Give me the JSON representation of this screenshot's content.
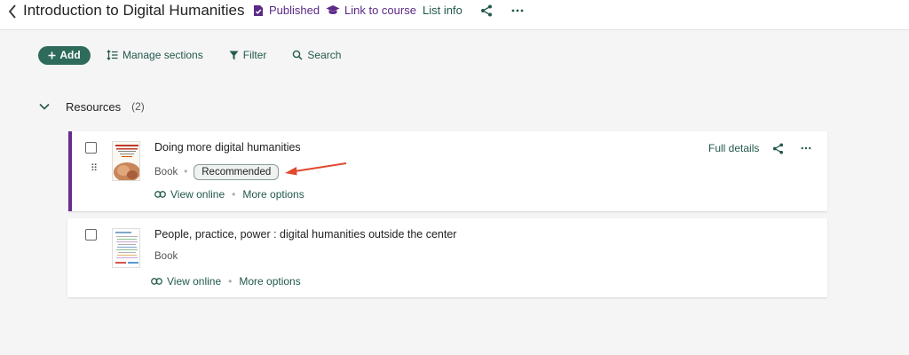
{
  "header": {
    "title": "Introduction to Digital Humanities",
    "published_label": "Published",
    "link_to_course_label": "Link to course",
    "list_info_label": "List info"
  },
  "toolbar": {
    "add_label": "Add",
    "manage_sections_label": "Manage sections",
    "filter_label": "Filter",
    "search_label": "Search"
  },
  "section": {
    "title": "Resources",
    "count": "(2)"
  },
  "items": [
    {
      "title": "Doing more digital humanities",
      "type": "Book",
      "tag": "Recommended",
      "view_online_label": "View online",
      "more_options_label": "More options",
      "full_details_label": "Full details",
      "cover_text": "DOING MORE DIGITAL HUMANITIES"
    },
    {
      "title": "People, practice, power : digital humanities outside the center",
      "type": "Book",
      "view_online_label": "View online",
      "more_options_label": "More options",
      "cover_text": "PRACTICE POWER"
    }
  ],
  "colors": {
    "accent_purple": "#6a2c8f",
    "link_teal": "#23594d",
    "add_button": "#2e6b5b",
    "annotation_arrow": "#e0482f"
  }
}
